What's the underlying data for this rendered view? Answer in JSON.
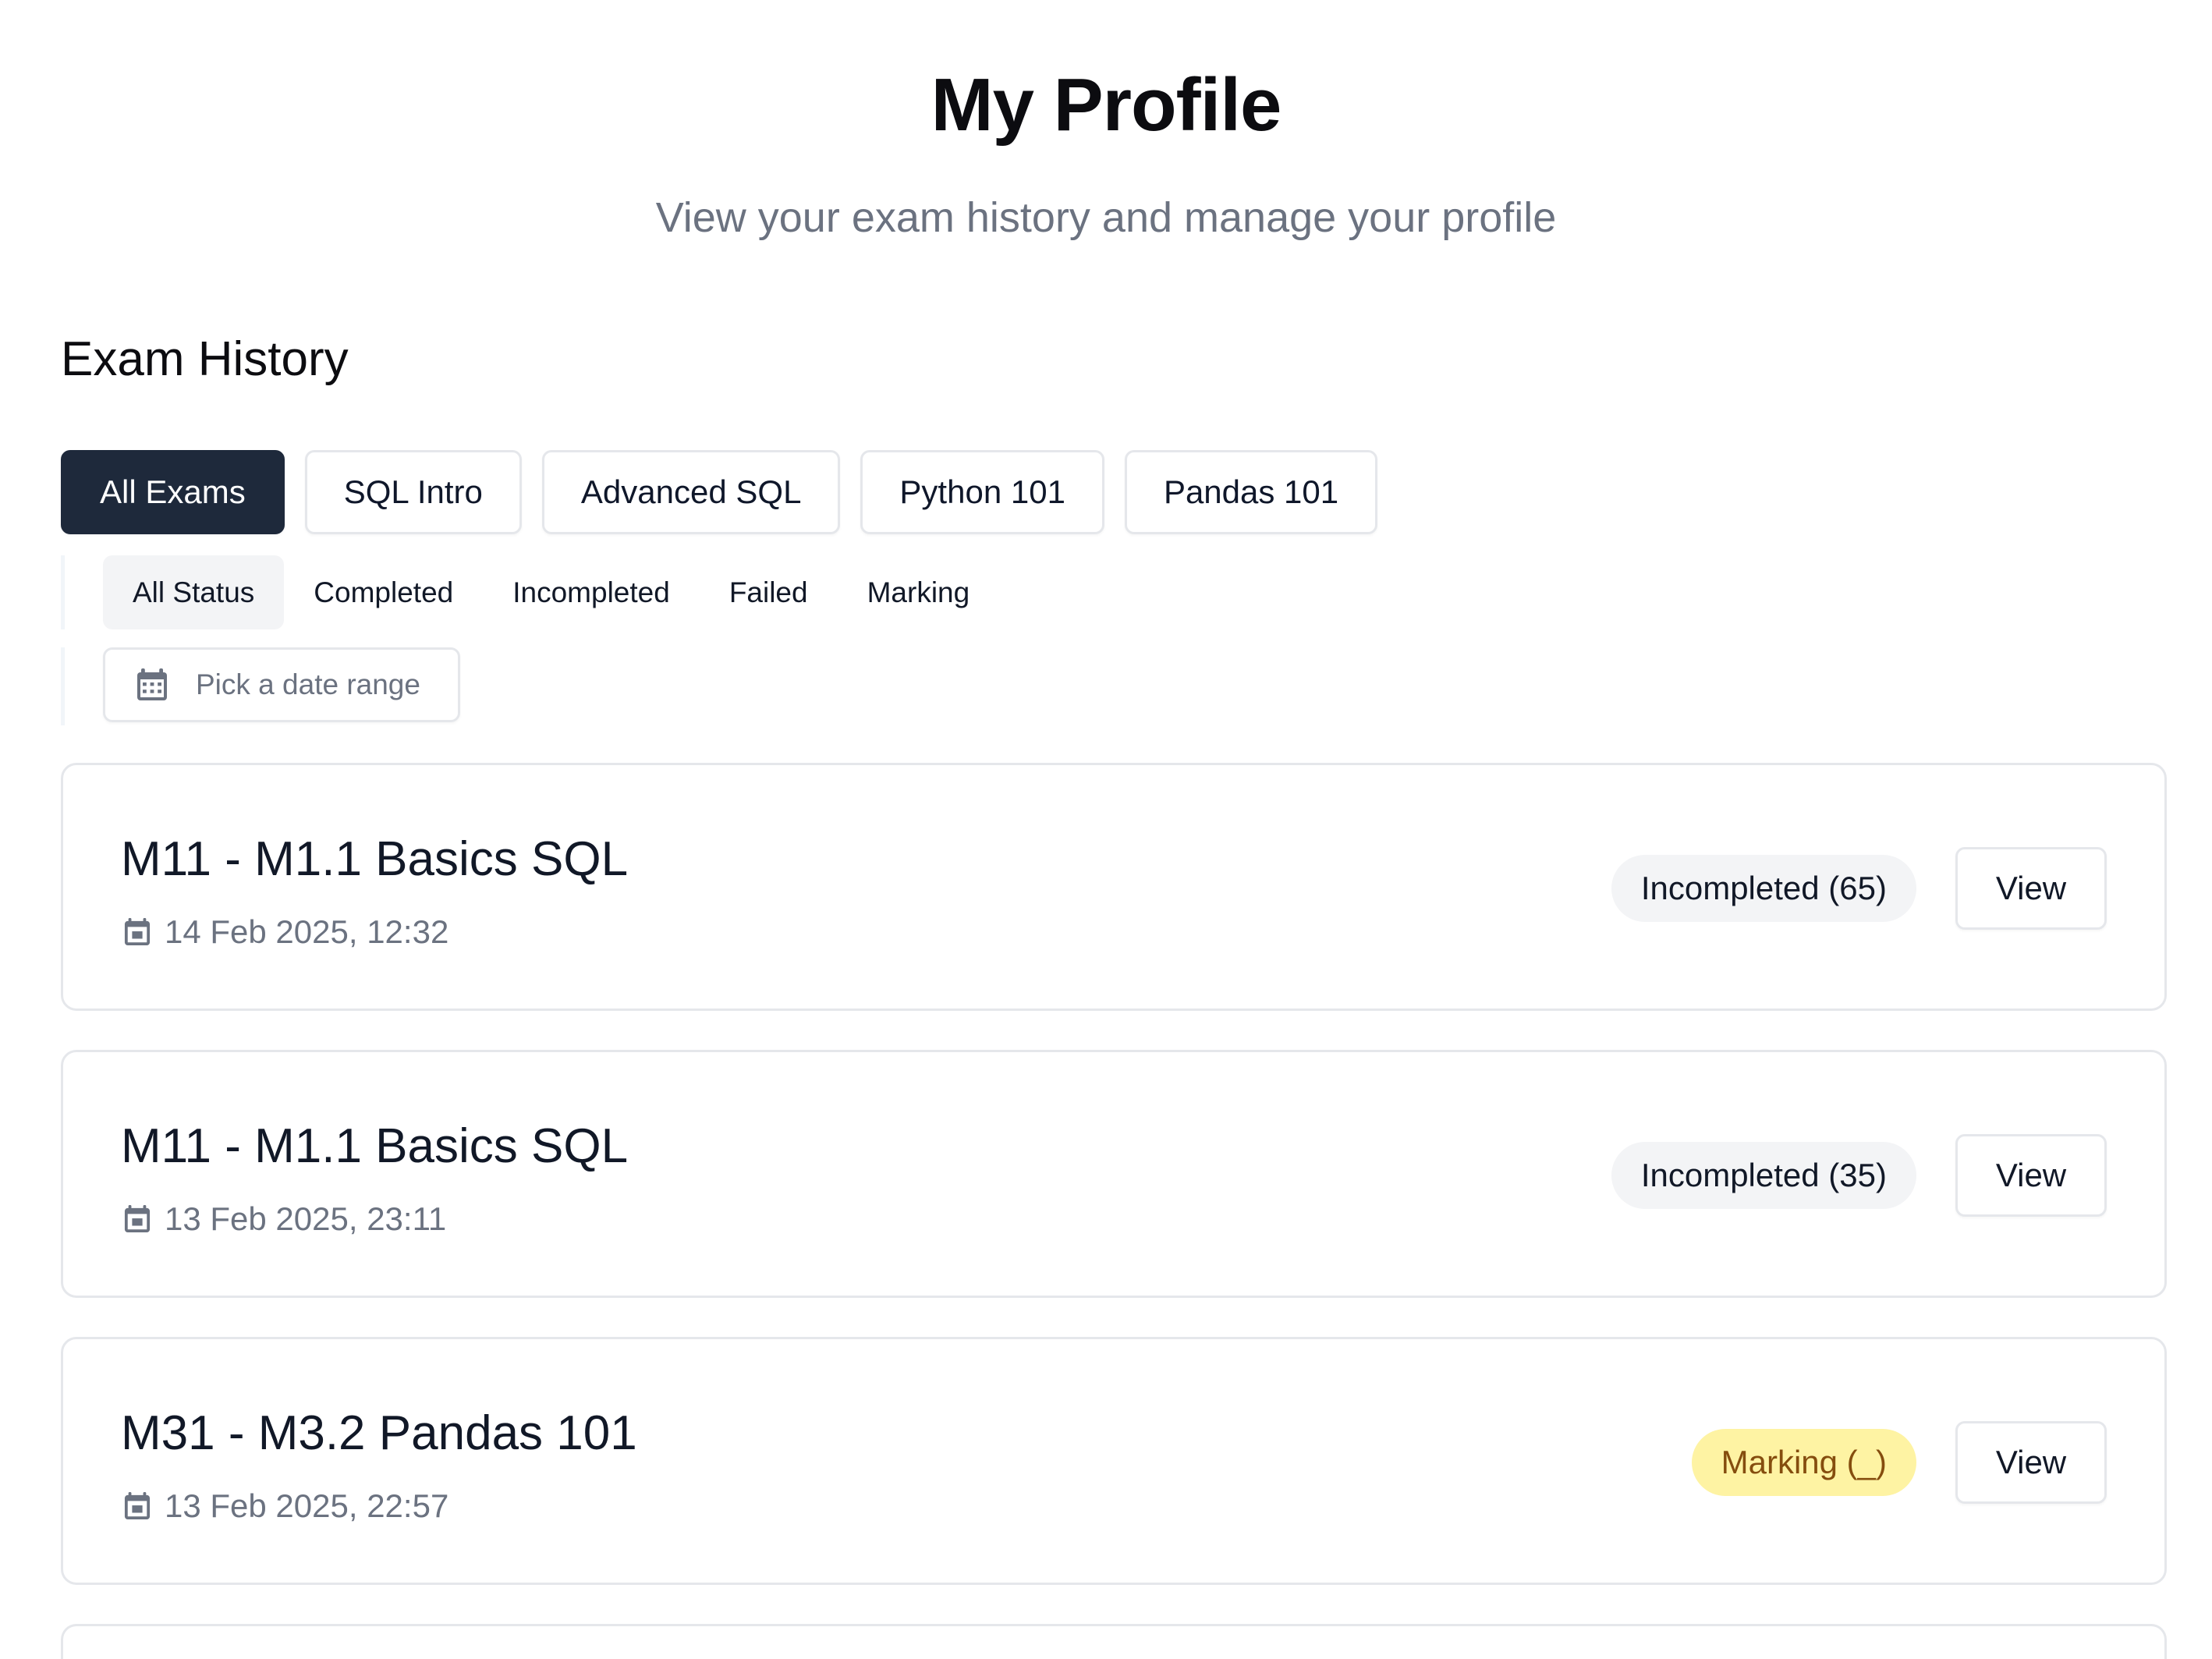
{
  "header": {
    "title": "My Profile",
    "subtitle": "View your exam history and manage your profile"
  },
  "exam_history": {
    "title": "Exam History",
    "exam_filters": [
      {
        "label": "All Exams",
        "active": true
      },
      {
        "label": "SQL Intro",
        "active": false
      },
      {
        "label": "Advanced SQL",
        "active": false
      },
      {
        "label": "Python 101",
        "active": false
      },
      {
        "label": "Pandas 101",
        "active": false
      }
    ],
    "status_filters": [
      {
        "label": "All Status",
        "active": true
      },
      {
        "label": "Completed",
        "active": false
      },
      {
        "label": "Incompleted",
        "active": false
      },
      {
        "label": "Failed",
        "active": false
      },
      {
        "label": "Marking",
        "active": false
      }
    ],
    "date_range": {
      "placeholder": "Pick a date range",
      "icon": "calendar-icon"
    },
    "exams": [
      {
        "title": "M11 - M1.1 Basics SQL",
        "date": "14 Feb 2025, 12:32",
        "status": "Incompleted (65)",
        "status_kind": "incompleted",
        "action": "View"
      },
      {
        "title": "M11 - M1.1 Basics SQL",
        "date": "13 Feb 2025, 23:11",
        "status": "Incompleted (35)",
        "status_kind": "incompleted",
        "action": "View"
      },
      {
        "title": "M31 - M3.2 Pandas 101",
        "date": "13 Feb 2025, 22:57",
        "status": "Marking (_)",
        "status_kind": "marking",
        "action": "View"
      }
    ]
  },
  "colors": {
    "active_filter_bg": "#1e293b",
    "badge_neutral_bg": "#f3f4f6",
    "badge_marking_bg": "#fef3a3",
    "badge_marking_text": "#854d0e"
  }
}
